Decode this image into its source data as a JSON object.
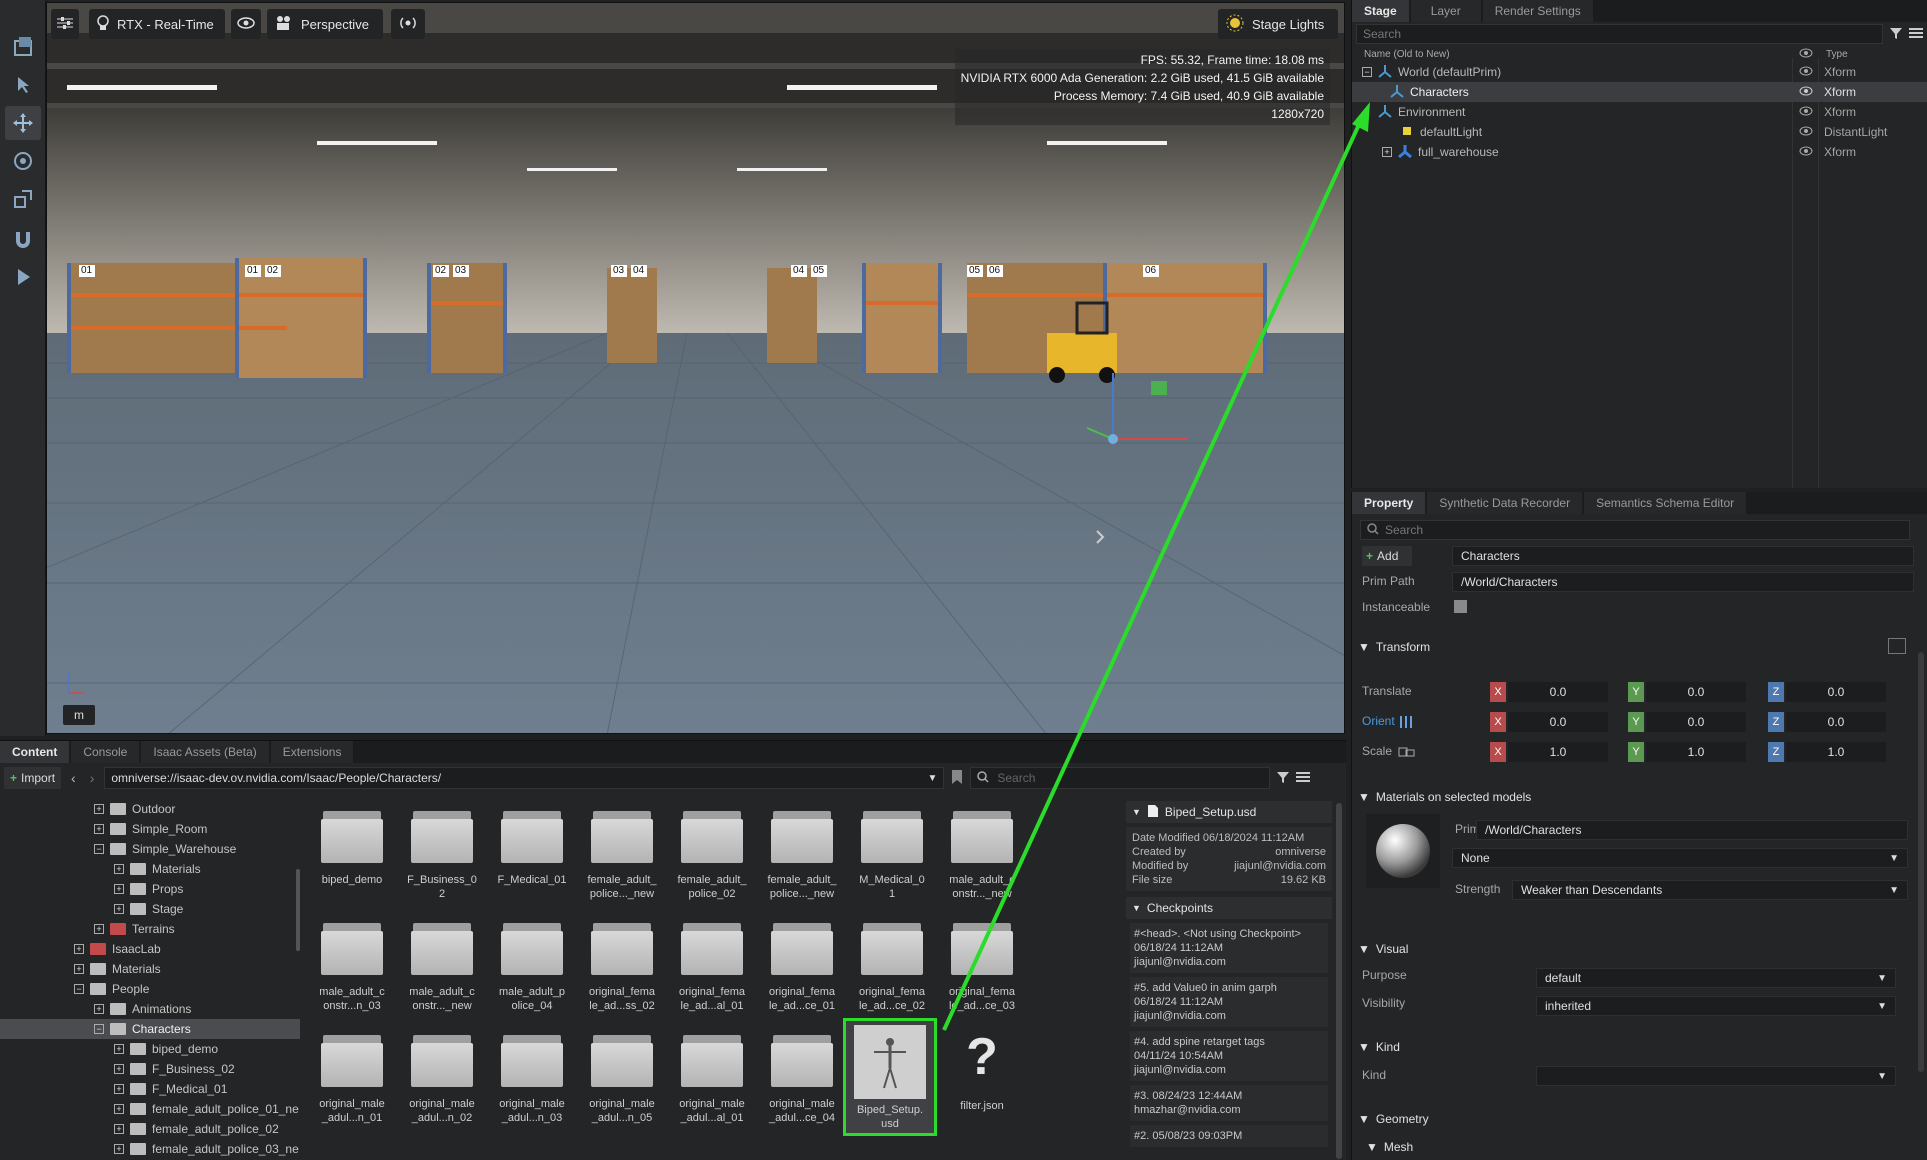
{
  "viewport": {
    "renderer": "RTX - Real-Time",
    "camera": "Perspective",
    "stage_lights": "Stage Lights",
    "stats": [
      "FPS: 55.32, Frame time: 18.08 ms",
      "NVIDIA RTX 6000 Ada Generation: 2.2 GiB used, 41.5 GiB available",
      "Process Memory: 7.4 GiB used, 40.9 GiB available",
      "1280x720"
    ],
    "rack_labels": [
      "01",
      "01",
      "02",
      "02",
      "03",
      "03",
      "04",
      "04",
      "05",
      "05",
      "06",
      "06"
    ],
    "mode_key": "m"
  },
  "stage": {
    "tabs": [
      "Stage",
      "Layer",
      "Render Settings"
    ],
    "search_placeholder": "Search",
    "col_name": "Name (Old to New)",
    "col_type": "Type",
    "rows": [
      {
        "name": "World (defaultPrim)",
        "type": "Xform"
      },
      {
        "name": "Characters",
        "type": "Xform"
      },
      {
        "name": "Environment",
        "type": "Xform"
      },
      {
        "name": "defaultLight",
        "type": "DistantLight"
      },
      {
        "name": "full_warehouse",
        "type": "Xform"
      }
    ]
  },
  "property": {
    "tabs": [
      "Property",
      "Synthetic Data Recorder",
      "Semantics Schema Editor"
    ],
    "search_placeholder": "Search",
    "add_label": "Add",
    "name_value": "Characters",
    "prim_path_label": "Prim Path",
    "prim_path_value": "/World/Characters",
    "instanceable_label": "Instanceable",
    "transform_title": "Transform",
    "translate_label": "Translate",
    "orient_label": "Orient",
    "scale_label": "Scale",
    "translate": [
      "0.0",
      "0.0",
      "0.0"
    ],
    "orient": [
      "0.0",
      "0.0",
      "0.0"
    ],
    "scale": [
      "1.0",
      "1.0",
      "1.0"
    ],
    "axes": [
      "X",
      "Y",
      "Z"
    ],
    "materials_title": "Materials on selected models",
    "prim_label": "Prim",
    "prim_value": "/World/Characters",
    "material_value": "None",
    "strength_label": "Strength",
    "strength_value": "Weaker than Descendants",
    "visual_title": "Visual",
    "purpose_label": "Purpose",
    "purpose_value": "default",
    "visibility_label": "Visibility",
    "visibility_value": "inherited",
    "kind_title": "Kind",
    "kind_label": "Kind",
    "kind_value": "",
    "geometry_title": "Geometry",
    "mesh_title": "Mesh"
  },
  "content": {
    "tabs": [
      "Content",
      "Console",
      "Isaac Assets (Beta)",
      "Extensions"
    ],
    "import_label": "Import",
    "path": "omniverse://isaac-dev.ov.nvidia.com/Isaac/People/Characters/",
    "search_placeholder": "Search",
    "tree": [
      {
        "label": "Outdoor",
        "indent": 1,
        "exp": "+"
      },
      {
        "label": "Simple_Room",
        "indent": 1,
        "exp": "+"
      },
      {
        "label": "Simple_Warehouse",
        "indent": 1,
        "exp": "−",
        "open": true
      },
      {
        "label": "Materials",
        "indent": 2,
        "exp": "+"
      },
      {
        "label": "Props",
        "indent": 2,
        "exp": "+"
      },
      {
        "label": "Stage",
        "indent": 2,
        "exp": "+"
      },
      {
        "label": "Terrains",
        "indent": 1,
        "exp": "+",
        "red": true
      },
      {
        "label": "IsaacLab",
        "indent": 0,
        "exp": "+",
        "red": true
      },
      {
        "label": "Materials",
        "indent": 0,
        "exp": "+"
      },
      {
        "label": "People",
        "indent": 0,
        "exp": "−",
        "open": true
      },
      {
        "label": "Animations",
        "indent": 1,
        "exp": "+"
      },
      {
        "label": "Characters",
        "indent": 1,
        "exp": "−",
        "open": true,
        "selected": true
      },
      {
        "label": "biped_demo",
        "indent": 2,
        "exp": "+"
      },
      {
        "label": "F_Business_02",
        "indent": 2,
        "exp": "+"
      },
      {
        "label": "F_Medical_01",
        "indent": 2,
        "exp": "+"
      },
      {
        "label": "female_adult_police_01_ne",
        "indent": 2,
        "exp": "+"
      },
      {
        "label": "female_adult_police_02",
        "indent": 2,
        "exp": "+"
      },
      {
        "label": "female_adult_police_03_ne",
        "indent": 2,
        "exp": "+"
      }
    ],
    "files": [
      "biped_demo",
      "F_Business_0\n2",
      "F_Medical_01",
      "female_adult_\npolice..._new",
      "female_adult_\npolice_02",
      "female_adult_\npolice..._new",
      "M_Medical_0\n1",
      "male_adult_c\nonstr..._new",
      "male_adult_c\nonstr...n_03",
      "male_adult_c\nonstr..._new",
      "male_adult_p\nolice_04",
      "original_fema\nle_ad...ss_02",
      "original_fema\nle_ad...al_01",
      "original_fema\nle_ad...ce_01",
      "original_fema\nle_ad...ce_02",
      "original_fema\nle_ad...ce_03",
      "original_male\n_adul...n_01",
      "original_male\n_adul...n_02",
      "original_male\n_adul...n_03",
      "original_male\n_adul...n_05",
      "original_male\n_adul...al_01",
      "original_male\n_adul...ce_04"
    ],
    "selected_file": "Biped_Setup.\nusd",
    "json_file": "filter.json",
    "details": {
      "filename": "Biped_Setup.usd",
      "date_modified": "Date Modified 06/18/2024 11:12AM",
      "created_by_label": "Created by",
      "created_by": "omniverse",
      "modified_by_label": "Modified by",
      "modified_by": "jiajunl@nvidia.com",
      "file_size_label": "File size",
      "file_size": "19.62 KB",
      "checkpoints_title": "Checkpoints",
      "checkpoints": [
        {
          "l1": "#<head>.   <Not using Checkpoint>",
          "l2": "06/18/24 11:12AM",
          "l3": "jiajunl@nvidia.com"
        },
        {
          "l1": "#5.   add Value0 in anim garph",
          "l2": "06/18/24 11:12AM",
          "l3": "jiajunl@nvidia.com"
        },
        {
          "l1": "#4.   add spine retarget tags",
          "l2": "04/11/24 10:54AM",
          "l3": "jiajunl@nvidia.com"
        },
        {
          "l1": "#3.   08/24/23 12:44AM",
          "l2": "hmazhar@nvidia.com",
          "l3": ""
        },
        {
          "l1": "#2.   05/08/23 09:03PM",
          "l2": "",
          "l3": ""
        }
      ]
    }
  },
  "colors": {
    "highlight": "#2bdc2b",
    "selection": "#3c3d40"
  }
}
